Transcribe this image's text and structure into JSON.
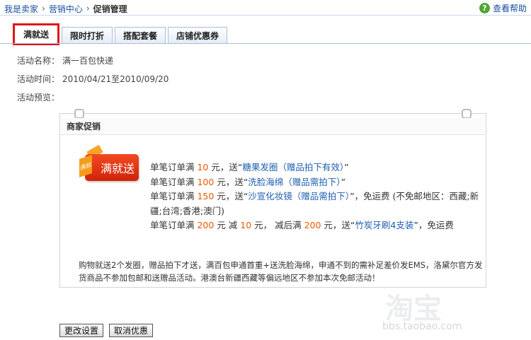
{
  "breadcrumb": {
    "items": [
      "我是卖家",
      "营销中心"
    ],
    "current": "促销管理",
    "separator": "›"
  },
  "help": {
    "label": "查看帮助",
    "icon": "question-icon"
  },
  "tabs": [
    {
      "label": "满就送",
      "active": true
    },
    {
      "label": "限时打折",
      "active": false
    },
    {
      "label": "搭配套餐",
      "active": false
    },
    {
      "label": "店铺优惠券",
      "active": false
    }
  ],
  "form": {
    "name_label": "活动名称：",
    "name_value": "满一百包快递",
    "time_label": "活动时间：",
    "time_value": "2010/04/21至2010/09/20",
    "preview_label": "活动预览："
  },
  "card": {
    "title": "商家促销",
    "badge_text": "满就送",
    "badge_tag": "满就",
    "rules": [
      {
        "pre": "单笔订单满 ",
        "num": "10",
        "mid": " 元，送“",
        "gift": "糖果发圈（赠品拍下有效）",
        "post": "”"
      },
      {
        "pre": "单笔订单满 ",
        "num": "100",
        "mid": " 元，送“",
        "gift": "洗脸海绵（赠品需拍下）",
        "post": "”"
      },
      {
        "pre": "单笔订单满 ",
        "num": "150",
        "mid": " 元，送“",
        "gift": "沙宣化妆镜（赠品需拍下）",
        "post": "”，免运费 (不免邮地区：西藏;新疆;台湾;香港;澳门)"
      },
      {
        "pre": "单笔订单满 ",
        "num": "200",
        "mid": " 元 减 ",
        "num2": "10",
        "mid2": " 元， 减后满 ",
        "num3": "200",
        "mid3": " 元，送“",
        "gift": "竹炭牙刷4支装",
        "post": "”，免运费"
      }
    ],
    "notice": "购物就送2个发圈，赠品拍下才送，满百包申通首重+送洗脸海绵，申通不到的需补足差价发EMS，洛黛尔官方发货商品不参加包邮和送赠品活动。港澳台新疆西藏等偏远地区不参加本次免邮活动！"
  },
  "watermark": {
    "text": "淘宝",
    "url": "bbs.taobao.com"
  },
  "buttons": {
    "change": "更改设置",
    "cancel": "取消优惠"
  }
}
